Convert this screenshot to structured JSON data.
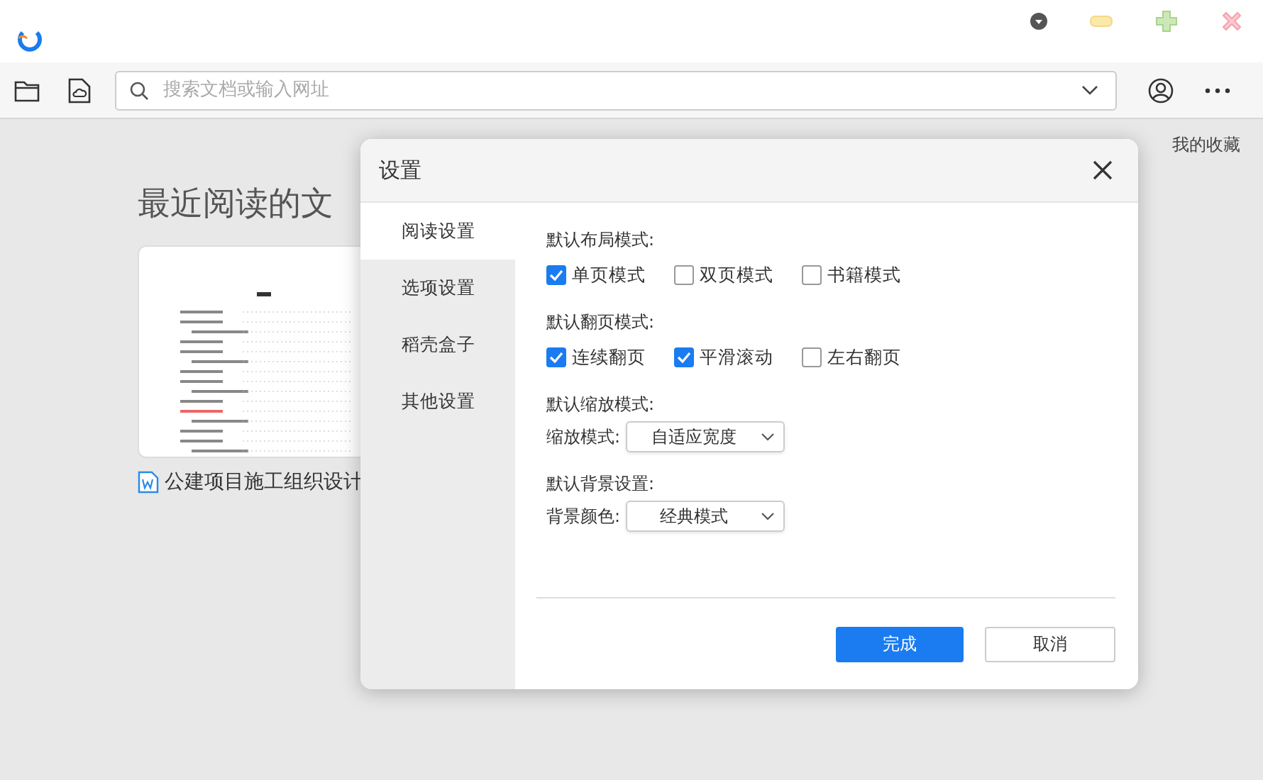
{
  "toolbar": {
    "search": {
      "placeholder": "搜索文档或输入网址"
    }
  },
  "page": {
    "favorites_link": "我的收藏",
    "heading": "最近阅读的文",
    "recent_files": [
      {
        "name": "公建项目施工组织设计"
      }
    ]
  },
  "dialog": {
    "title": "设置",
    "nav": [
      {
        "label": "阅读设置",
        "selected": true
      },
      {
        "label": "选项设置",
        "selected": false
      },
      {
        "label": "稻壳盒子",
        "selected": false
      },
      {
        "label": "其他设置",
        "selected": false
      }
    ],
    "sections": [
      {
        "kind": "checkboxes",
        "title": "默认布局模式:",
        "options": [
          {
            "label": "单页模式",
            "checked": true
          },
          {
            "label": "双页模式",
            "checked": false
          },
          {
            "label": "书籍模式",
            "checked": false
          }
        ]
      },
      {
        "kind": "checkboxes",
        "title": "默认翻页模式:",
        "options": [
          {
            "label": "连续翻页",
            "checked": true
          },
          {
            "label": "平滑滚动",
            "checked": true
          },
          {
            "label": "左右翻页",
            "checked": false
          }
        ]
      },
      {
        "kind": "select",
        "title": "默认缩放模式:",
        "label": "缩放模式:",
        "value": "自适应宽度"
      },
      {
        "kind": "select",
        "title": "默认背景设置:",
        "label": "背景颜色:",
        "value": "经典模式"
      }
    ],
    "buttons": [
      {
        "label": "完成",
        "primary": true
      },
      {
        "label": "取消",
        "primary": false
      }
    ]
  }
}
